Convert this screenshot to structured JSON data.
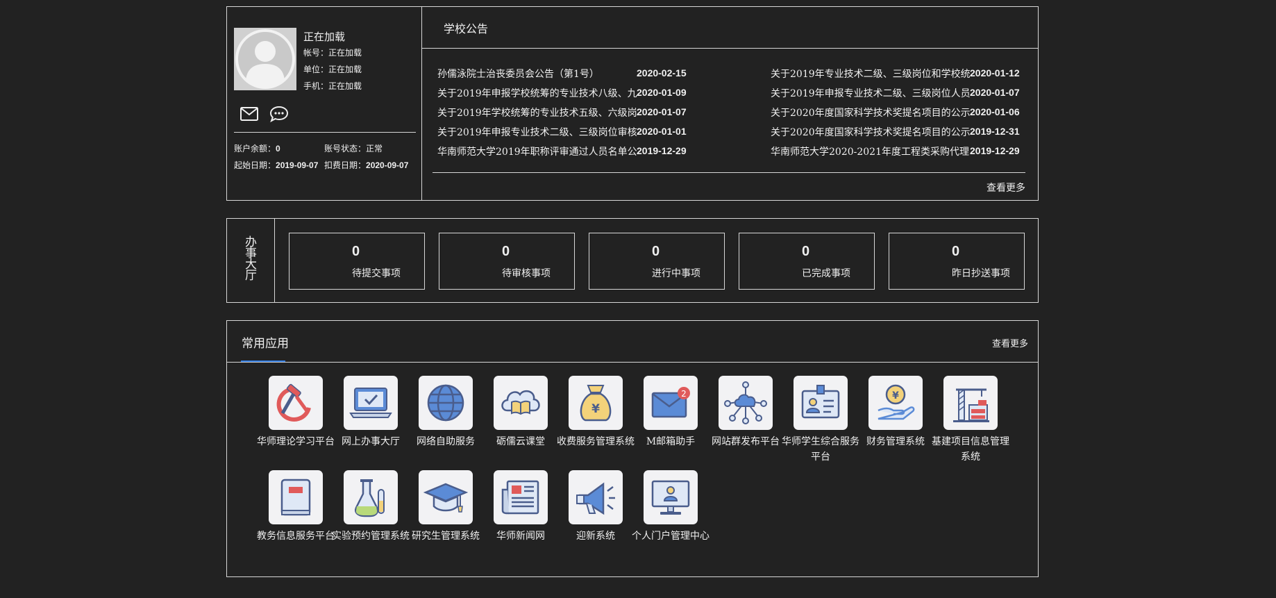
{
  "profile": {
    "name": "正在加载",
    "account": "帐号：正在加载",
    "unit": "单位：正在加载",
    "phone": "手机：正在加载",
    "balance_label": "账户余额：",
    "balance_value": "0",
    "status_label": "账号状态：",
    "status_value": "正常",
    "start_label": "起始日期：",
    "start_value": "2019-09-07",
    "deduct_label": "扣费日期：",
    "deduct_value": "2020-09-07"
  },
  "notices": {
    "title": "学校公告",
    "more": "查看更多",
    "left": [
      {
        "title": "孙儒泳院士治丧委员会公告（第1号）",
        "date": "2020-02-15"
      },
      {
        "title": "关于2019年申报学校统筹的专业技术八级、九",
        "date": "2020-01-09"
      },
      {
        "title": "关于2019年学校统筹的专业技术五级、六级岗",
        "date": "2020-01-07"
      },
      {
        "title": "关于2019年申报专业技术二级、三级岗位审核",
        "date": "2020-01-01"
      },
      {
        "title": "华南师范大学2019年职称评审通过人员名单公",
        "date": "2019-12-29"
      }
    ],
    "right": [
      {
        "title": "关于2019年专业技术二级、三级岗位和学校统",
        "date": "2020-01-12"
      },
      {
        "title": "关于2019年申报专业技术二级、三级岗位人员",
        "date": "2020-01-07"
      },
      {
        "title": "关于2020年度国家科学技术奖提名项目的公示",
        "date": "2020-01-06"
      },
      {
        "title": "关于2020年度国家科学技术奖提名项目的公示",
        "date": "2019-12-31"
      },
      {
        "title": "华南师范大学2020-2021年度工程类采购代理",
        "date": "2019-12-29"
      }
    ]
  },
  "hall": {
    "title": "办事大厅",
    "stats": [
      {
        "count": "0",
        "label": "待提交事项"
      },
      {
        "count": "0",
        "label": "待审核事项"
      },
      {
        "count": "0",
        "label": "进行中事项"
      },
      {
        "count": "0",
        "label": "已完成事项"
      },
      {
        "count": "0",
        "label": "昨日抄送事项"
      }
    ]
  },
  "apps": {
    "title": "常用应用",
    "more": "查看更多",
    "mail_badge": "2",
    "items": [
      {
        "label": "华师理论学习平台",
        "icon": "hammer-sickle-icon"
      },
      {
        "label": "网上办事大厅",
        "icon": "laptop-check-icon"
      },
      {
        "label": "网络自助服务",
        "icon": "globe-icon"
      },
      {
        "label": "砺儒云课堂",
        "icon": "cloud-book-icon"
      },
      {
        "label": "收费服务管理系统",
        "icon": "money-bag-icon"
      },
      {
        "label": "M邮箱助手",
        "icon": "mail-badge-icon"
      },
      {
        "label": "网站群发布平台",
        "icon": "cloud-network-icon"
      },
      {
        "label": "华师学生综合服务平台",
        "icon": "id-card-icon"
      },
      {
        "label": "财务管理系统",
        "icon": "hand-coin-icon"
      },
      {
        "label": "基建项目信息管理系统",
        "icon": "crane-building-icon"
      },
      {
        "label": "教务信息服务平台",
        "icon": "book-icon"
      },
      {
        "label": "实验预约管理系统",
        "icon": "flask-icon"
      },
      {
        "label": "研究生管理系统",
        "icon": "graduation-cap-icon"
      },
      {
        "label": "华师新闻网",
        "icon": "newspaper-icon"
      },
      {
        "label": "迎新系统",
        "icon": "megaphone-icon"
      },
      {
        "label": "个人门户管理中心",
        "icon": "monitor-user-icon"
      }
    ]
  },
  "colors": {
    "background": "#222222",
    "border": "#d8d8d8",
    "accent": "#2f7be0",
    "icon_tile": "#f2f2f4",
    "icon_stroke": "#4a5d8c",
    "icon_red": "#e05a5a",
    "icon_blue": "#5b8bd6",
    "icon_yellow": "#f3d27a"
  }
}
